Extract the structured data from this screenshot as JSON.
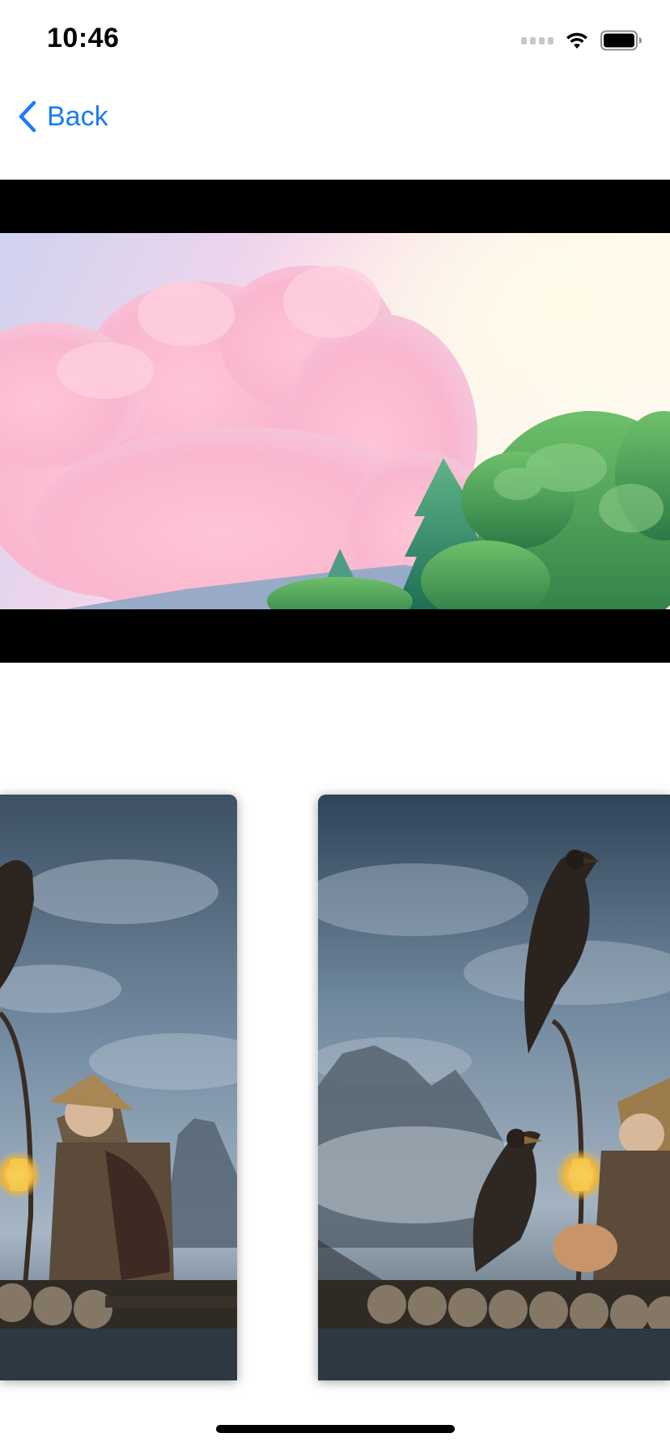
{
  "status_bar": {
    "time": "10:46",
    "signal_icon": "cellular-signal-icon",
    "wifi_icon": "wifi-icon",
    "battery_icon": "battery-icon"
  },
  "nav": {
    "back_icon": "chevron-left-icon",
    "back_label": "Back"
  },
  "banner": {
    "image": "pink-clouds-forest-landscape"
  },
  "carousel": {
    "items": [
      {
        "image": "fisherman-cormorant-lantern"
      },
      {
        "image": "cormorants-bamboo-raft-mountains"
      }
    ]
  },
  "colors": {
    "accent": "#1a7cf5",
    "background": "#ffffff",
    "letterbox": "#000000"
  }
}
